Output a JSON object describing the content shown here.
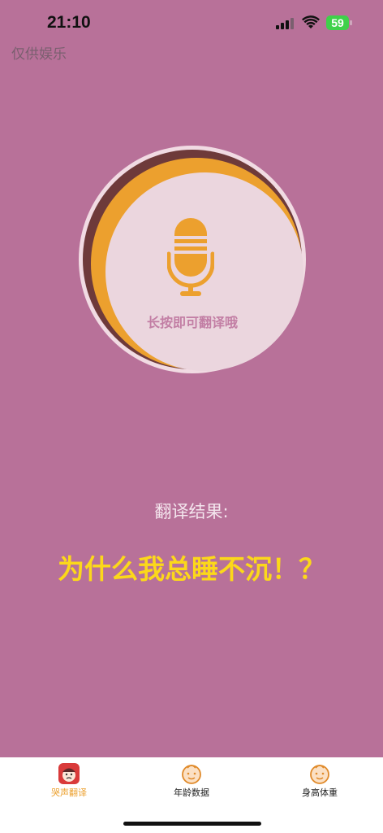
{
  "status": {
    "time": "21:10",
    "battery": "59"
  },
  "disclaimer": "仅供娱乐",
  "mic": {
    "hint": "长按即可翻译哦",
    "icon": "microphone-icon"
  },
  "result": {
    "label": "翻译结果:",
    "text": "为什么我总睡不沉！？"
  },
  "tabs": [
    {
      "label": "哭声翻译",
      "icon": "crying-baby-icon",
      "active": true
    },
    {
      "label": "年龄数据",
      "icon": "baby-face-icon",
      "active": false
    },
    {
      "label": "身高体重",
      "icon": "baby-face-icon",
      "active": false
    }
  ],
  "colors": {
    "background": "#b87199",
    "accent": "#eca02e",
    "result_text": "#fcd81a",
    "hint": "#c27ea4"
  }
}
